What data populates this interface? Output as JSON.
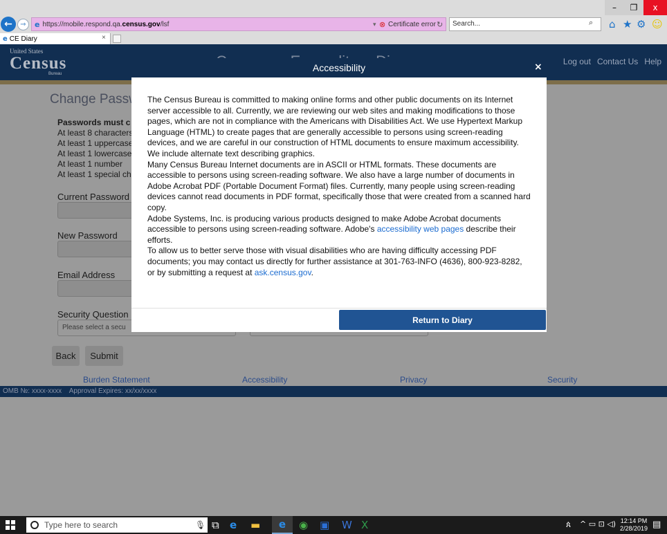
{
  "browser": {
    "url_prefix": "https://mobile.respond.qa.",
    "url_domain": "census.gov",
    "url_suffix": "/lsf",
    "cert_error": "Certificate error",
    "search_placeholder": "Search...",
    "tab_title": "CE Diary",
    "window_buttons": {
      "minimize": "–",
      "maximize": "❐",
      "close": "x"
    },
    "icons": {
      "back": "back-arrow-icon",
      "forward": "forward-arrow-icon",
      "home": "home-icon",
      "favorites": "star-icon",
      "tools": "gear-icon",
      "feedback": "smiley-icon"
    }
  },
  "header": {
    "logo_united": "United States",
    "logo_census": "Census",
    "logo_bureau": "Bureau",
    "title": "Consumer Expenditure Diary",
    "links": [
      "Log out",
      "Contact Us",
      "Help"
    ]
  },
  "form": {
    "title": "Change Passw",
    "rules_head": "Passwords must c",
    "rules": [
      "At least 8 characters",
      "At least 1 uppercase",
      "At least 1 lowercase",
      "At least 1 number",
      "At least 1 special ch"
    ],
    "current_password_label": "Current Password",
    "new_password_label": "New Password",
    "email_label": "Email Address",
    "security_question_label": "Security Question",
    "security_question_placeholder": "Please select a secu",
    "back_label": "Back",
    "submit_label": "Submit"
  },
  "footer": {
    "links": [
      "Burden Statement",
      "Accessibility",
      "Privacy",
      "Security"
    ],
    "omb": "OMB №: xxxx-xxxx    Approval Expires: xx/xx/xxxx"
  },
  "modal": {
    "title": "Accessibility",
    "close": "×",
    "p1": "The Census Bureau is committed to making online forms and other public documents on its Internet server accessible to all. Currently, we are reviewing our web sites and making modifications to those pages, which are not in compliance with the Americans with Disabilities Act. We use Hypertext Markup Language (HTML) to create pages that are generally accessible to persons using screen-reading devices, and we are careful in our construction of HTML documents to ensure maximum accessibility. We include alternate text describing graphics.",
    "p2": "Many Census Bureau Internet documents are in ASCII or HTML formats. These documents are accessible to persons using screen-reading software. We also have a large number of documents in Adobe Acrobat PDF (Portable Document Format) files. Currently, many people using screen-reading devices cannot read documents in PDF format, specifically those that were created from a scanned hard copy.",
    "p3_before": "Adobe Systems, Inc. is producing various products designed to make Adobe Acrobat documents accessible to persons using screen-reading software. Adobe's ",
    "p3_link": "accessibility web pages",
    "p3_after": " describe their efforts.",
    "p4_before": "To allow us to better serve those with visual disabilities who are having difficulty accessing PDF documents; you may contact us directly for further assistance at 301-763-INFO (4636), 800-923-8282, or by submitting a request at ",
    "p4_link": "ask.census.gov",
    "p4_after": ".",
    "button": "Return to Diary"
  },
  "taskbar": {
    "search_placeholder": "Type here to search",
    "time": "12:14 PM",
    "date": "2/28/2019"
  },
  "colors": {
    "header_navy": "#112e51",
    "button_blue": "#205493",
    "link_blue": "#1a6bd0",
    "address_pink": "#e8b4e8"
  }
}
